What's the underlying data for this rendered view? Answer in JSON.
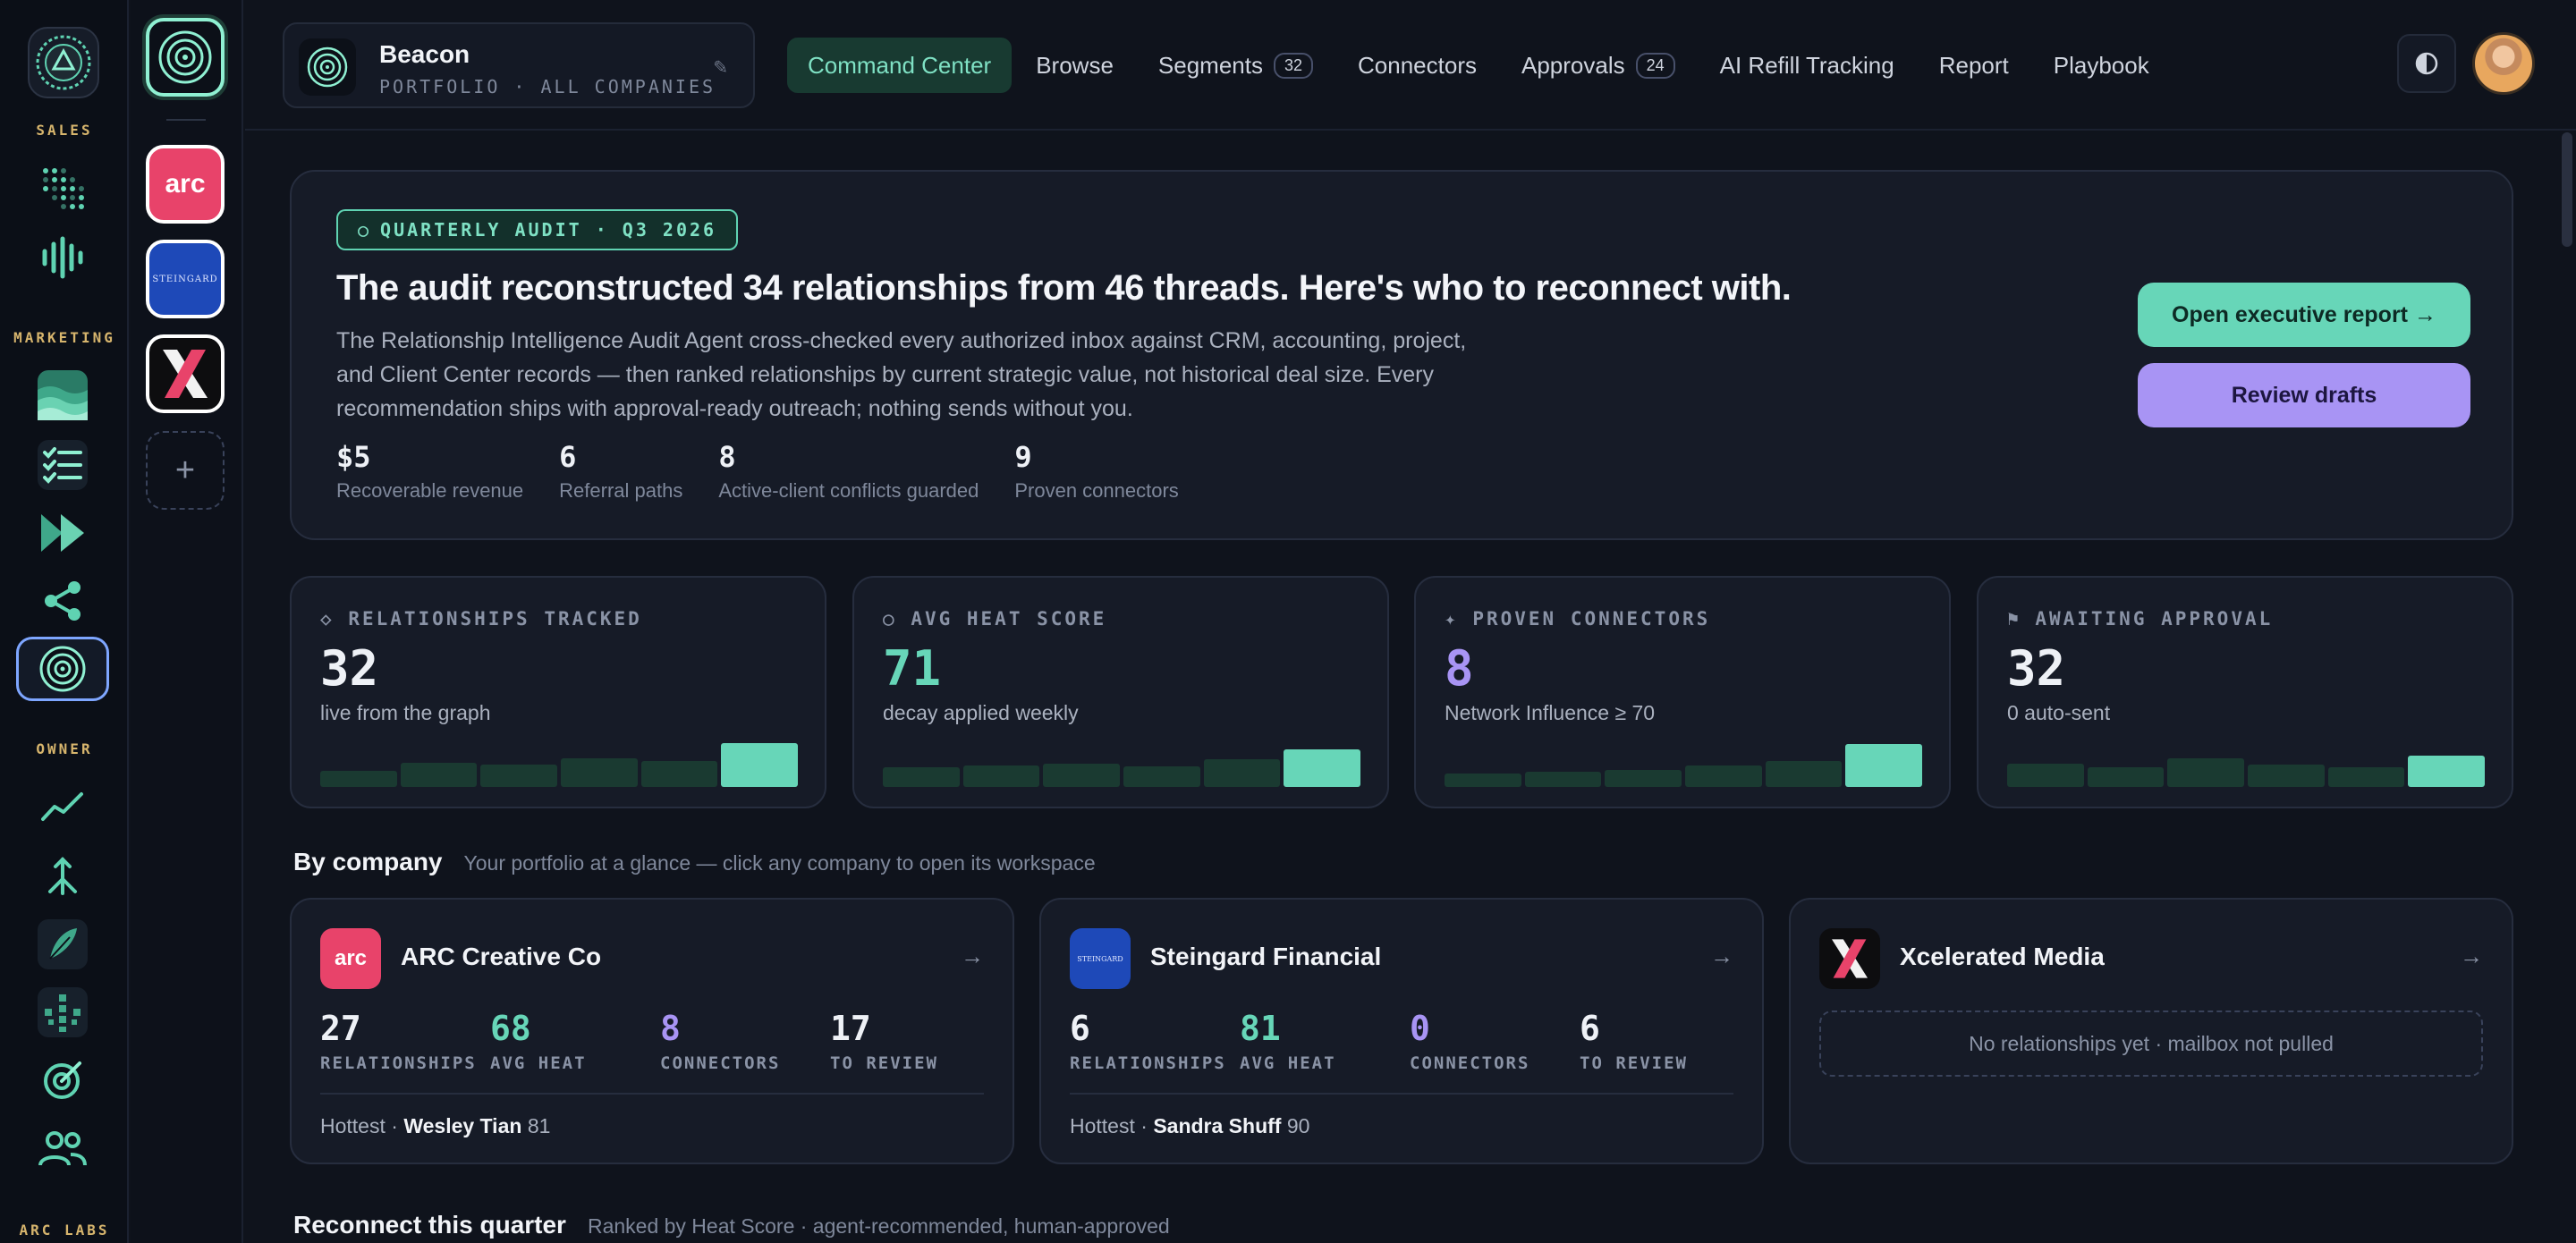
{
  "rail": {
    "sections": [
      "SALES",
      "MARKETING",
      "OWNER",
      "ARC LABS"
    ],
    "icons": [
      "dot-grid-icon",
      "waveform-icon",
      "waves-icon",
      "checklist-icon",
      "fast-forward-icon",
      "share-nodes-icon",
      "target-rings-icon",
      "trend-line-icon",
      "arrow-split-icon",
      "feather-icon",
      "crosshair-grid-icon",
      "dart-target-icon",
      "users-icon"
    ]
  },
  "companies_column": {
    "items": [
      {
        "name": "Beacon",
        "logo_text": ""
      },
      {
        "name": "ARC Creative Co",
        "logo_text": "arc"
      },
      {
        "name": "Steingard Financial",
        "logo_text": "STEINGARD"
      },
      {
        "name": "Xcelerated Media",
        "logo_text": "X"
      }
    ],
    "add_label": "+"
  },
  "brand": {
    "name": "Beacon",
    "subtitle": "PORTFOLIO · ALL COMPANIES",
    "edit_glyph": "✎"
  },
  "nav": {
    "tabs": [
      {
        "label": "Command Center",
        "badge": null,
        "active": true
      },
      {
        "label": "Browse",
        "badge": null
      },
      {
        "label": "Segments",
        "badge": "32"
      },
      {
        "label": "Connectors",
        "badge": null
      },
      {
        "label": "Approvals",
        "badge": "24"
      },
      {
        "label": "AI Refill Tracking",
        "badge": null
      },
      {
        "label": "Report",
        "badge": null
      },
      {
        "label": "Playbook",
        "badge": null
      }
    ]
  },
  "hero": {
    "pill": "QUARTERLY AUDIT · Q3 2026",
    "pill_glyph": "○",
    "title": "The audit reconstructed 34 relationships from 46 threads. Here's who to reconnect with.",
    "description": "The Relationship Intelligence Audit Agent cross-checked every authorized inbox against CRM, accounting, project, and Client Center records — then ranked relationships by current strategic value, not historical deal size. Every recommendation ships with approval-ready outreach; nothing sends without you.",
    "stats": [
      {
        "value": "$5",
        "label": "Recoverable revenue"
      },
      {
        "value": "6",
        "label": "Referral paths"
      },
      {
        "value": "8",
        "label": "Active-client conflicts guarded"
      },
      {
        "value": "9",
        "label": "Proven connectors"
      }
    ],
    "primary_button": "Open executive report →",
    "secondary_button": "Review drafts"
  },
  "kpis": [
    {
      "icon": "◇",
      "label": "RELATIONSHIPS TRACKED",
      "value": "32",
      "sub": "live from the graph",
      "color": "#eef1f6",
      "bars": [
        0.35,
        0.52,
        0.48,
        0.62,
        0.55,
        0.95
      ]
    },
    {
      "icon": "○",
      "label": "AVG HEAT SCORE",
      "value": "71",
      "sub": "decay applied weekly",
      "color": "#67d6b8",
      "bars": [
        0.42,
        0.46,
        0.5,
        0.44,
        0.6,
        0.8
      ]
    },
    {
      "icon": "✦",
      "label": "PROVEN CONNECTORS",
      "value": "8",
      "sub": "Network Influence ≥ 70",
      "color": "#a894f4",
      "bars": [
        0.28,
        0.32,
        0.36,
        0.46,
        0.56,
        0.92
      ]
    },
    {
      "icon": "⚑",
      "label": "AWAITING APPROVAL",
      "value": "32",
      "sub": "0 auto-sent",
      "color": "#eef1f6",
      "bars": [
        0.5,
        0.42,
        0.62,
        0.48,
        0.42,
        0.68
      ]
    }
  ],
  "by_company": {
    "title": "By company",
    "subtitle": "Your portfolio at a glance — click any company to open its workspace",
    "cards": [
      {
        "name": "ARC Creative Co",
        "logo_text": "arc",
        "logo_bg": "#e8436a",
        "metrics": [
          {
            "value": "27",
            "label": "RELATIONSHIPS",
            "color": "#eef1f6"
          },
          {
            "value": "68",
            "label": "AVG HEAT",
            "color": "#67d6b8"
          },
          {
            "value": "8",
            "label": "CONNECTORS",
            "color": "#a894f4"
          },
          {
            "value": "17",
            "label": "TO REVIEW",
            "color": "#eef1f6"
          }
        ],
        "hottest_prefix": "Hottest · ",
        "hottest_name": "Wesley Tian",
        "hottest_score": "81"
      },
      {
        "name": "Steingard Financial",
        "logo_text": "STEINGARD",
        "logo_bg": "#1e49b8",
        "metrics": [
          {
            "value": "6",
            "label": "RELATIONSHIPS",
            "color": "#eef1f6"
          },
          {
            "value": "81",
            "label": "AVG HEAT",
            "color": "#67d6b8"
          },
          {
            "value": "0",
            "label": "CONNECTORS",
            "color": "#a894f4"
          },
          {
            "value": "6",
            "label": "TO REVIEW",
            "color": "#eef1f6"
          }
        ],
        "hottest_prefix": "Hottest · ",
        "hottest_name": "Sandra Shuff",
        "hottest_score": "90"
      },
      {
        "name": "Xcelerated Media",
        "logo_text": "X",
        "logo_bg": "#0d0d0f",
        "empty": "No relationships yet · mailbox not pulled"
      }
    ]
  },
  "reconnect": {
    "title": "Reconnect this quarter",
    "subtitle": "Ranked by Heat Score · agent-recommended, human-approved"
  }
}
